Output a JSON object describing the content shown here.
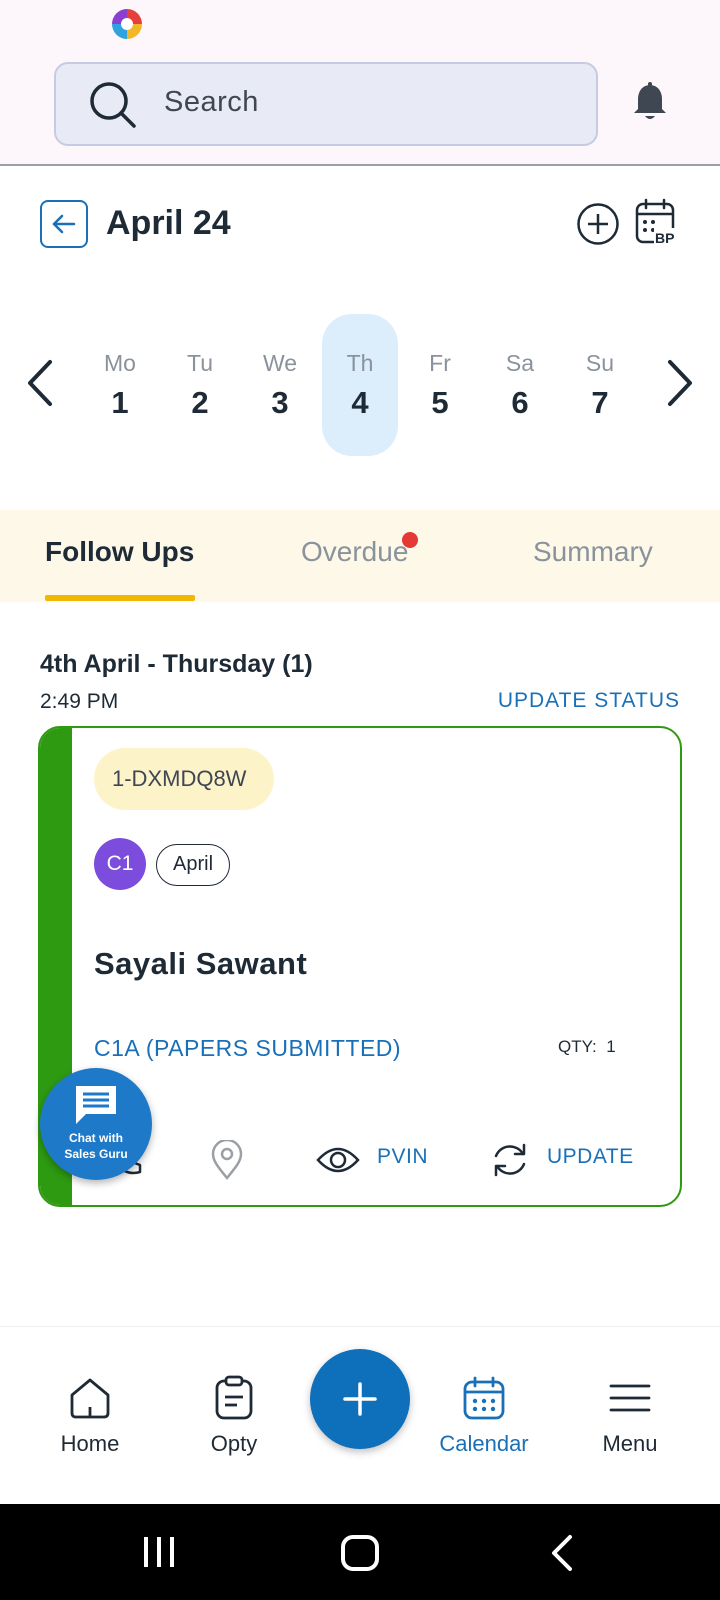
{
  "search": {
    "placeholder": "Search"
  },
  "header": {
    "date_title": "April 24"
  },
  "week": {
    "days": [
      {
        "name": "Mo",
        "date": "1"
      },
      {
        "name": "Tu",
        "date": "2"
      },
      {
        "name": "We",
        "date": "3"
      },
      {
        "name": "Th",
        "date": "4",
        "selected": true
      },
      {
        "name": "Fr",
        "date": "5"
      },
      {
        "name": "Sa",
        "date": "6"
      },
      {
        "name": "Su",
        "date": "7"
      }
    ]
  },
  "tabs": [
    {
      "label": "Follow Ups",
      "active": true
    },
    {
      "label": "Overdue",
      "badge": true
    },
    {
      "label": "Summary"
    }
  ],
  "followups": {
    "group_title": "4th April - Thursday (1)",
    "time": "2:49 PM",
    "update_status_label": "UPDATE STATUS",
    "card": {
      "opty_id": "1-DXMDQ8W",
      "avatar_initials": "C1",
      "chip": "April",
      "customer_name": "Sayali Sawant",
      "stage": "C1A (PAPERS SUBMITTED)",
      "qty_label": "QTY:",
      "qty_value": "1",
      "actions": {
        "pvin_label": "PVIN",
        "update_label": "UPDATE"
      }
    }
  },
  "chat_fab": {
    "line1": "Chat with",
    "line2": "Sales Guru"
  },
  "bottom_nav": {
    "home": "Home",
    "opty": "Opty",
    "calendar": "Calendar",
    "menu": "Menu"
  },
  "colors": {
    "accent": "#1a70b8",
    "card_border": "#2e9a12",
    "tab_underline": "#f2b705",
    "badge": "#e53935"
  }
}
